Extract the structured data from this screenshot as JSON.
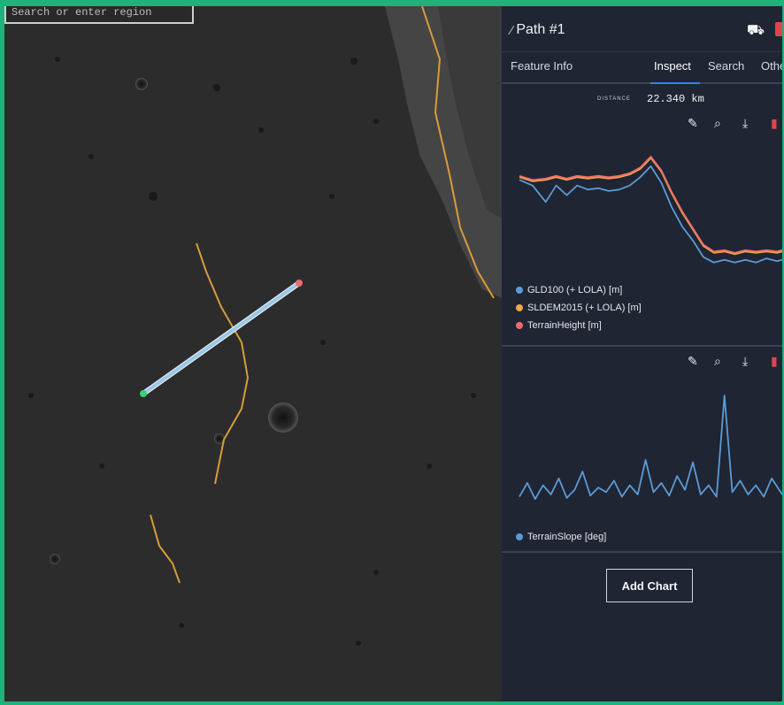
{
  "map": {
    "search_text": "Search or enter region",
    "colors": {
      "surface": "#2a2a2a",
      "feature_line": "#d99b3a",
      "path_line": "#9cc8e6",
      "path_start": "#39d27a",
      "path_end": "#e87070"
    }
  },
  "panel": {
    "path_title": "Path #1",
    "header_icons": [
      "pencil-icon",
      "binoculars-icon",
      "trash-icon"
    ],
    "tabs": [
      {
        "label": "Feature Info",
        "active": false
      },
      {
        "label": "Inspect",
        "active": true
      },
      {
        "label": "Search",
        "active": false
      },
      {
        "label": "Othe",
        "active": false
      }
    ],
    "distance_label": "DISTANCE",
    "distance_value": "22.340 km",
    "chart_tools": [
      "pencil-icon",
      "zoom-icon",
      "download-icon",
      "trash-icon"
    ],
    "add_chart_label": "Add Chart"
  },
  "chart_data": [
    {
      "type": "line",
      "title": "",
      "x_range": [
        0,
        100
      ],
      "series": [
        {
          "name": "GLD100 (+ LOLA) [m]",
          "color": "#5b9bd5",
          "x": [
            0,
            5,
            10,
            14,
            18,
            22,
            26,
            30,
            34,
            38,
            42,
            46,
            50,
            54,
            58,
            62,
            66,
            70,
            74,
            78,
            82,
            86,
            90,
            94,
            98,
            100
          ],
          "y": [
            64,
            60,
            48,
            60,
            53,
            60,
            57,
            58,
            56,
            57,
            60,
            66,
            74,
            62,
            44,
            30,
            20,
            8,
            4,
            6,
            4,
            6,
            4,
            7,
            5,
            6
          ]
        },
        {
          "name": "SLDEM2015 (+ LOLA) [m]",
          "color": "#f0a64b",
          "x": [
            0,
            5,
            10,
            14,
            18,
            22,
            26,
            30,
            34,
            38,
            42,
            46,
            50,
            54,
            58,
            62,
            66,
            70,
            74,
            78,
            82,
            86,
            90,
            94,
            98,
            100
          ],
          "y": [
            66,
            63,
            64,
            66,
            64,
            66,
            65,
            66,
            65,
            66,
            68,
            72,
            80,
            70,
            54,
            40,
            28,
            16,
            11,
            12,
            10,
            12,
            11,
            12,
            11,
            12
          ]
        },
        {
          "name": "TerrainHeight [m]",
          "color": "#f06b6b",
          "x": [
            0,
            5,
            10,
            14,
            18,
            22,
            26,
            30,
            34,
            38,
            42,
            46,
            50,
            54,
            58,
            62,
            66,
            70,
            74,
            78,
            82,
            86,
            90,
            94,
            98,
            100
          ],
          "y": [
            67,
            64,
            65,
            67,
            65,
            67,
            66,
            67,
            66,
            67,
            69,
            73,
            81,
            71,
            55,
            41,
            29,
            17,
            12,
            13,
            11,
            13,
            12,
            13,
            12,
            13
          ]
        }
      ]
    },
    {
      "type": "line",
      "title": "",
      "x_range": [
        0,
        100
      ],
      "series": [
        {
          "name": "TerrainSlope [deg]",
          "color": "#5b9bd5",
          "x": [
            0,
            3,
            6,
            9,
            12,
            15,
            18,
            21,
            24,
            27,
            30,
            33,
            36,
            39,
            42,
            45,
            48,
            51,
            54,
            57,
            60,
            63,
            66,
            69,
            72,
            75,
            78,
            81,
            84,
            87,
            90,
            93,
            96,
            100
          ],
          "y": [
            8,
            20,
            6,
            18,
            10,
            24,
            7,
            14,
            30,
            9,
            16,
            12,
            22,
            8,
            18,
            10,
            40,
            12,
            20,
            9,
            26,
            14,
            38,
            10,
            18,
            8,
            96,
            12,
            22,
            10,
            18,
            8,
            24,
            10
          ]
        }
      ]
    }
  ]
}
